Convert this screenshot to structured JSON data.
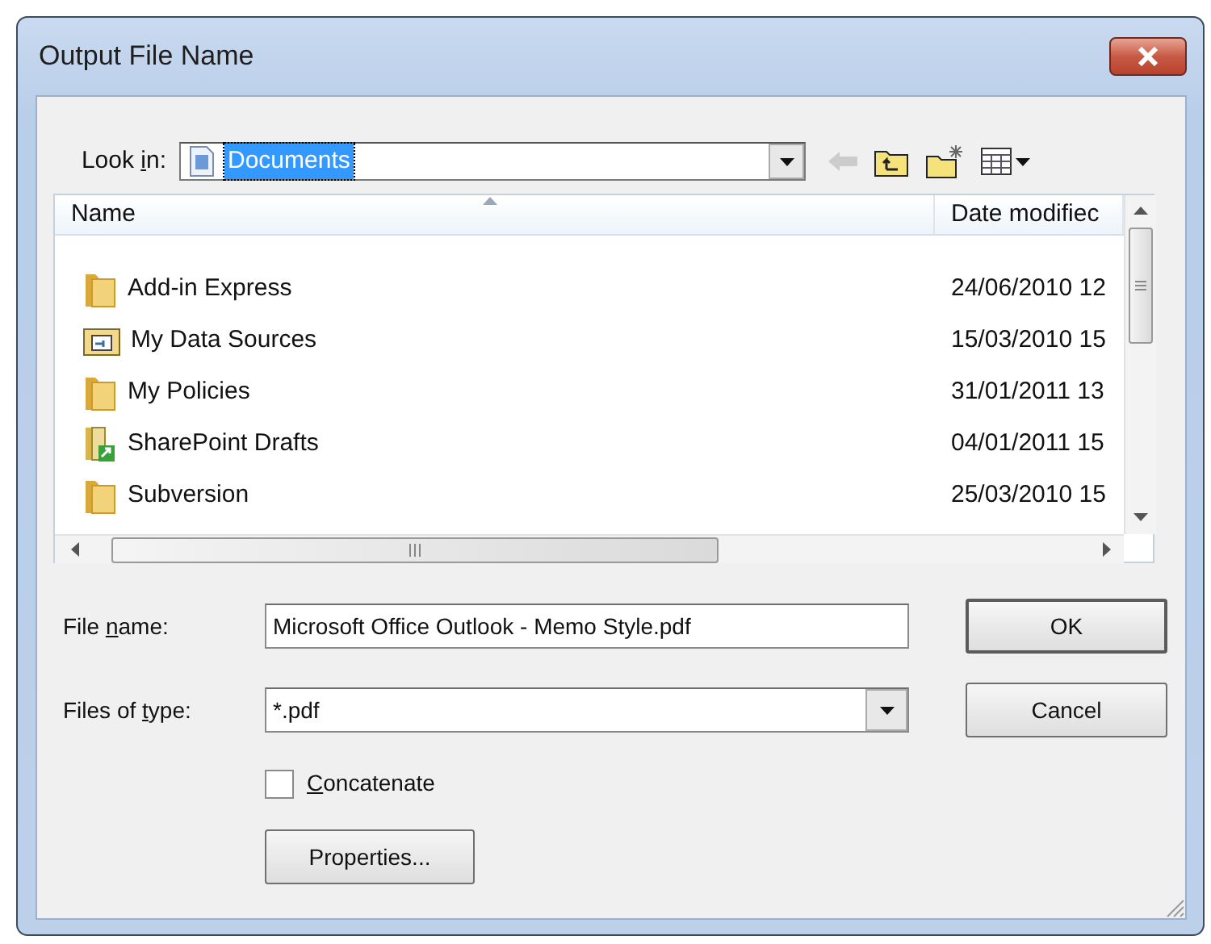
{
  "window": {
    "title": "Output File Name"
  },
  "look_in": {
    "label_before": "Look ",
    "label_key": "i",
    "label_after": "n:",
    "value": "Documents",
    "text_selected": true
  },
  "toolbar": [
    {
      "kind": "back",
      "disabled": true
    },
    {
      "kind": "up",
      "disabled": false
    },
    {
      "kind": "new-folder",
      "disabled": false
    },
    {
      "kind": "views",
      "disabled": false
    }
  ],
  "file_list": {
    "columns": [
      "Name",
      "Date modifiec"
    ],
    "rows": [
      {
        "kind": "folder",
        "name": "Add-in Express",
        "date": "24/06/2010 12"
      },
      {
        "kind": "data-sources",
        "name": "My Data Sources",
        "date": "15/03/2010 15"
      },
      {
        "kind": "folder",
        "name": "My Policies",
        "date": "31/01/2011 13"
      },
      {
        "kind": "sharepoint",
        "name": "SharePoint Drafts",
        "date": "04/01/2011 15"
      },
      {
        "kind": "folder",
        "name": "Subversion",
        "date": "25/03/2010 15"
      }
    ]
  },
  "file_name": {
    "label_before": "File ",
    "label_key": "n",
    "label_after": "ame:",
    "value": "Microsoft Office Outlook - Memo Style.pdf"
  },
  "file_type": {
    "label_before": "Files of ",
    "label_key": "t",
    "label_after": "ype:",
    "value": "*.pdf"
  },
  "concatenate": {
    "label_key": "C",
    "label_after": "oncatenate",
    "checked": false
  },
  "buttons": [
    {
      "label": "OK",
      "default": true
    },
    {
      "label": "Cancel",
      "default": false
    },
    {
      "label": "Properties...",
      "default": false
    }
  ]
}
